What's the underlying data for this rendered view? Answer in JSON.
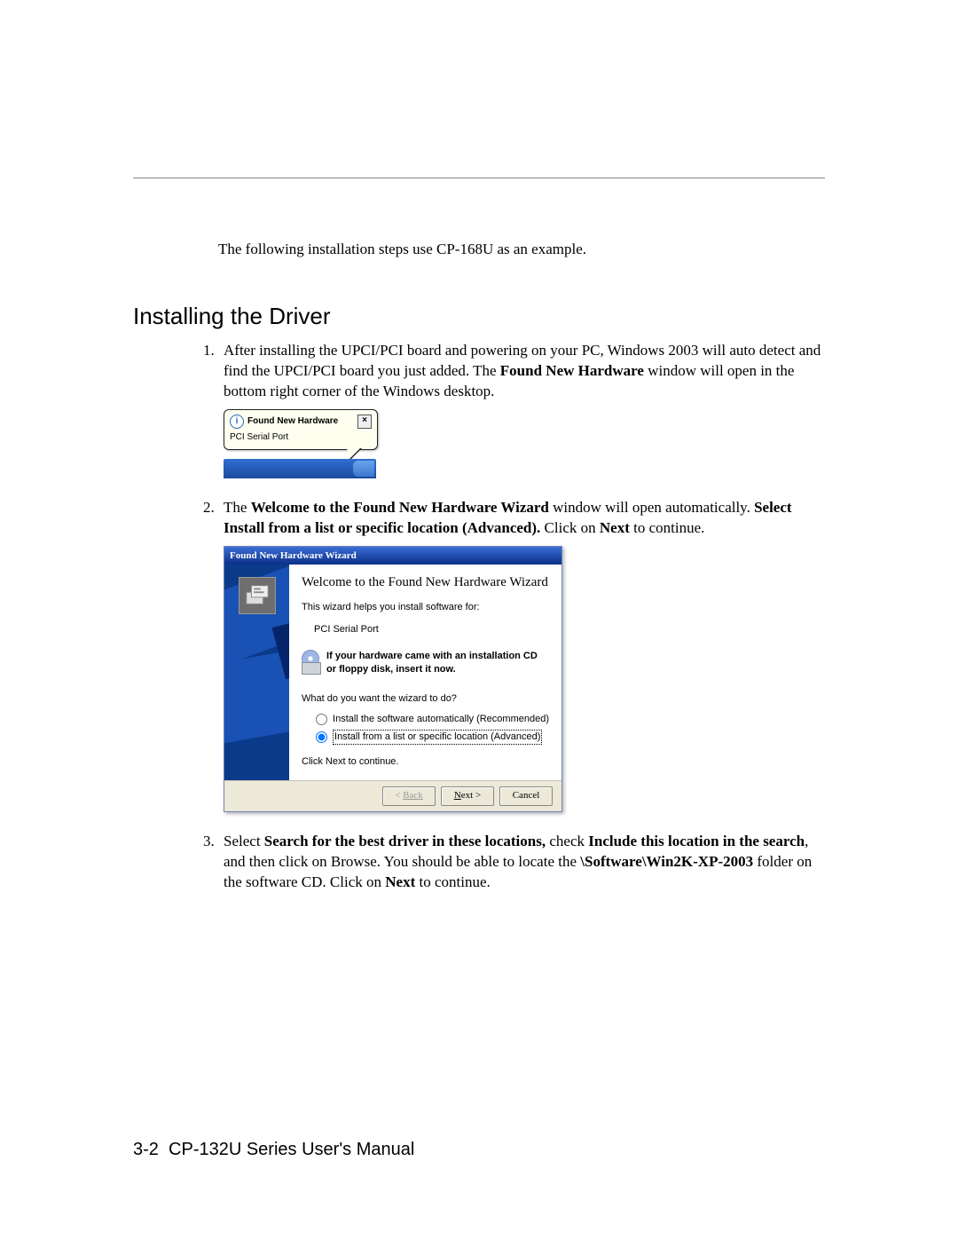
{
  "intro": "The following installation steps use CP-168U as an example.",
  "section_title": "Installing the Driver",
  "step1": {
    "t1": "After installing the UPCI/PCI board and powering on your PC, Windows 2003 will auto detect and find the UPCI/PCI board you just added. The ",
    "b1": "Found New Hardware",
    "t2": " window will open in the bottom right corner of the Windows desktop."
  },
  "balloon": {
    "title": "Found New Hardware",
    "device": "PCI Serial Port"
  },
  "step2": {
    "t1": "The ",
    "b1": "Welcome to the Found New Hardware Wizard",
    "t2": " window will open automatically. ",
    "b2": "Select Install from a list or specific location (Advanced).",
    "t3": " Click on ",
    "b3": "Next",
    "t4": " to continue."
  },
  "wizard": {
    "titlebar": "Found New Hardware Wizard",
    "heading": "Welcome to the Found New Hardware Wizard",
    "sub": "This wizard helps you install software for:",
    "device": "PCI Serial Port",
    "cd_line1": "If your hardware came with an installation CD",
    "cd_line2": "or floppy disk, insert it now.",
    "ask": "What do you want the wizard to do?",
    "radio_auto": "Install the software automatically (Recommended)",
    "radio_list": "Install from a list or specific location (Advanced)",
    "continue": "Click Next to continue.",
    "back": "Back",
    "next": "Next >",
    "cancel": "Cancel"
  },
  "step3": {
    "t1": "Select ",
    "b1": "Search for the best driver in these locations,",
    "t2": " check ",
    "b2": "Include this location in the search",
    "t3": ", and then click on Browse. You should be able to locate the ",
    "b3": "\\Software\\Win2K-XP-2003",
    "t4": " folder on the software CD. Click on ",
    "b4": "Next",
    "t5": " to continue."
  },
  "footer": {
    "page": "3-2",
    "manual": "CP-132U Series User's Manual"
  }
}
